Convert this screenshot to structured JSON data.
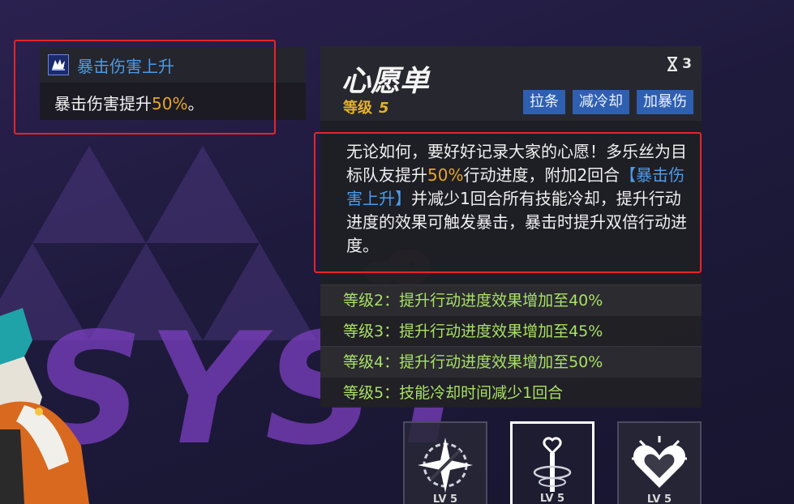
{
  "background": {
    "brand_text": "SYST"
  },
  "buff": {
    "icon": "crit-burst-icon",
    "title": "暴击伤害上升",
    "desc_prefix": "暴击伤害提升",
    "desc_value": "50%",
    "desc_suffix": "。"
  },
  "skill": {
    "name": "心愿单",
    "level_label": "等级",
    "level_value": "5",
    "cost_icon": "hourglass-icon",
    "cost_value": "3",
    "tags": [
      "拉条",
      "减冷却",
      "加暴伤"
    ],
    "description": {
      "part1": "无论如何，要好好记录大家的心愿！多乐丝为目标队友提升",
      "value": "50%",
      "part2": "行动进度，附加2回合",
      "buff_link": "【暴击伤害上升】",
      "part3": "并减少1回合所有技能冷却，提升行动进度的效果可触发暴击，暴击时提升双倍行动进度。"
    },
    "upgrades": [
      "等级2：提升行动进度效果增加至40%",
      "等级3：提升行动进度效果增加至45%",
      "等级4：提升行动进度效果增加至50%",
      "等级5：技能冷却时间减少1回合"
    ]
  },
  "slots": [
    {
      "icon": "starburst-icon",
      "level": "LV 5",
      "active": false
    },
    {
      "icon": "key-wand-icon",
      "level": "LV 5",
      "active": true
    },
    {
      "icon": "heart-icon",
      "level": "LV 5",
      "active": false
    }
  ],
  "colors": {
    "highlight_gold": "#e6a526",
    "highlight_blue": "#4c9be8",
    "upgrade_green": "#a8e065",
    "tag_blue": "#2f5fb0",
    "annotation_red": "#e8232a"
  }
}
